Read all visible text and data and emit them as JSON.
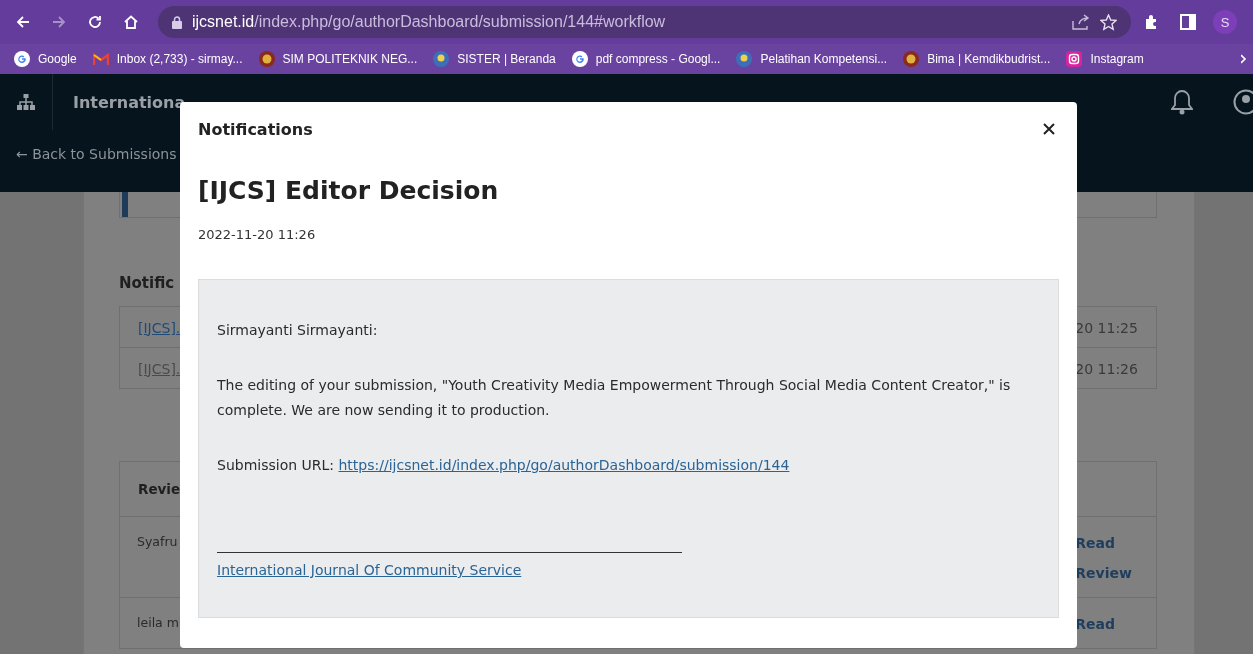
{
  "browser": {
    "url": {
      "host": "ijcsnet.id",
      "path": "/index.php/go/authorDashboard/submission/144#workflow"
    },
    "profile_initial": "S",
    "bookmarks": [
      {
        "label": "Google",
        "kind": "google"
      },
      {
        "label": "Inbox (2,733) - sirmay...",
        "kind": "mail"
      },
      {
        "label": "SIM POLITEKNIK NEG...",
        "kind": "emblem"
      },
      {
        "label": "SISTER | Beranda",
        "kind": "seal"
      },
      {
        "label": "pdf compress - Googl...",
        "kind": "google"
      },
      {
        "label": "Pelatihan Kompetensi...",
        "kind": "seal"
      },
      {
        "label": "Bima | Kemdikbudrist...",
        "kind": "emblem"
      },
      {
        "label": "Instagram",
        "kind": "instagram"
      }
    ]
  },
  "app_header": {
    "title": "Internationa",
    "back_link": "← Back to Submissions"
  },
  "background": {
    "notifications_heading": "Notific",
    "notifications": [
      {
        "title": "[IJCS].",
        "time": "20 11:25",
        "visited": false
      },
      {
        "title": "[IJCS].",
        "time": "20 11:26",
        "visited": true
      }
    ],
    "reviews_heading": "Revie",
    "reviews": [
      {
        "name": "Syafru",
        "actions": [
          "Read",
          "Review"
        ]
      },
      {
        "name": "leila m",
        "actions": [
          "Read"
        ]
      }
    ]
  },
  "modal": {
    "header": "Notifications",
    "title": "[IJCS] Editor Decision",
    "date": "2022-11-20 11:26",
    "message": {
      "greeting": "Sirmayanti Sirmayanti:",
      "body": "The editing of your submission, \"Youth Creativity Media Empowerment Through Social Media Content Creator,\" is complete. We are now sending it to production.",
      "url_label": "Submission URL: ",
      "url": "https://ijcsnet.id/index.php/go/authorDashboard/submission/144",
      "signature": "International Journal Of Community Service"
    }
  }
}
